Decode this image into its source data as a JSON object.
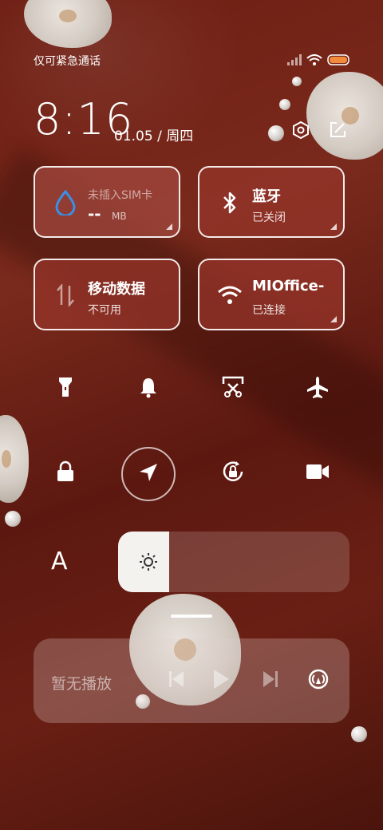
{
  "status_bar": {
    "carrier": "仅可紧急通话",
    "icons": [
      "signal-icon",
      "wifi-icon",
      "battery-icon"
    ]
  },
  "header": {
    "time": "8:16",
    "date": "01.05 / 周四",
    "settings_icon": "gear-icon",
    "edit_icon": "edit-icon"
  },
  "tiles": [
    {
      "id": "data-usage",
      "title": "未插入SIM卡",
      "value": "--",
      "unit": "MB",
      "icon": "water-drop-icon"
    },
    {
      "id": "bluetooth",
      "title": "蓝牙",
      "subtitle": "已关闭",
      "icon": "bluetooth-icon"
    },
    {
      "id": "mobile-data",
      "title": "移动数据",
      "subtitle": "不可用",
      "icon": "mobile-data-icon"
    },
    {
      "id": "wifi",
      "title": "MIOffice-",
      "subtitle": "已连接",
      "icon": "wifi-icon"
    }
  ],
  "quick_toggles": [
    {
      "name": "flashlight",
      "icon": "flashlight-icon"
    },
    {
      "name": "bell",
      "icon": "bell-icon"
    },
    {
      "name": "screenshot",
      "icon": "scissors-icon"
    },
    {
      "name": "airplane",
      "icon": "airplane-icon"
    },
    {
      "name": "lock",
      "icon": "lock-icon"
    },
    {
      "name": "location",
      "icon": "location-arrow-icon"
    },
    {
      "name": "rotation-lock",
      "icon": "rotation-lock-icon"
    },
    {
      "name": "screen-record",
      "icon": "video-camera-icon"
    }
  ],
  "brightness": {
    "auto_label": "A",
    "level": 0.22
  },
  "media": {
    "title": "暂无播放",
    "controls": [
      "previous-icon",
      "play-icon",
      "next-icon",
      "cast-icon"
    ]
  },
  "colors": {
    "accent_blue": "#3a8fe6",
    "tile_border": "#ffffff"
  }
}
